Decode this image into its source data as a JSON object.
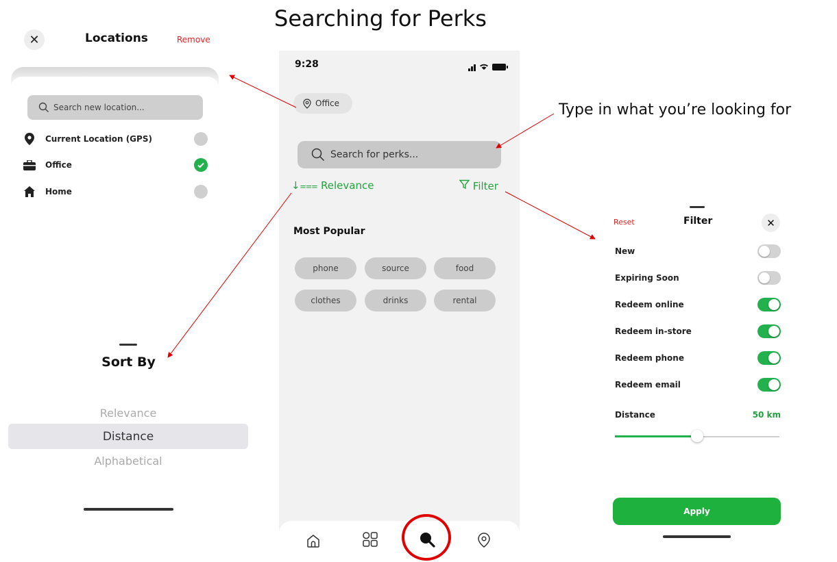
{
  "page_title": "Searching for Perks",
  "annotation": "Type in what you’re looking for",
  "locations_panel": {
    "close_icon": "close-icon",
    "title": "Locations",
    "remove_label": "Remove",
    "search_placeholder": "Search new location...",
    "items": [
      {
        "label": "Current Location (GPS)",
        "icon": "pin-icon",
        "selected": false
      },
      {
        "label": "Office",
        "icon": "briefcase-icon",
        "selected": true
      },
      {
        "label": "Home",
        "icon": "house-icon",
        "selected": false
      }
    ]
  },
  "sort_panel": {
    "title": "Sort By",
    "options": [
      "Relevance",
      "Distance",
      "Alphabetical"
    ],
    "selected": "Distance"
  },
  "phone": {
    "time": "9:28",
    "location_chip": "Office",
    "search_placeholder": "Search for perks...",
    "sort_label": "Relevance",
    "filter_label": "Filter",
    "popular_heading": "Most Popular",
    "tags": [
      "phone",
      "source",
      "food",
      "clothes",
      "drinks",
      "rental"
    ],
    "tabs": [
      "home-icon",
      "grid-icon",
      "search-icon",
      "location-icon"
    ],
    "active_tab": "search-icon"
  },
  "filter_panel": {
    "reset_label": "Reset",
    "title": "Filter",
    "toggles": [
      {
        "label": "New",
        "on": false
      },
      {
        "label": "Expiring Soon",
        "on": false
      },
      {
        "label": "Redeem online",
        "on": true
      },
      {
        "label": "Redeem in-store",
        "on": true
      },
      {
        "label": "Redeem phone",
        "on": true
      },
      {
        "label": "Redeem email",
        "on": true
      }
    ],
    "distance_label": "Distance",
    "distance_value": "50 km",
    "distance_fraction": 0.5,
    "apply_label": "Apply"
  },
  "colors": {
    "accent_green": "#22b14c",
    "annotation_red": "#e00000"
  }
}
